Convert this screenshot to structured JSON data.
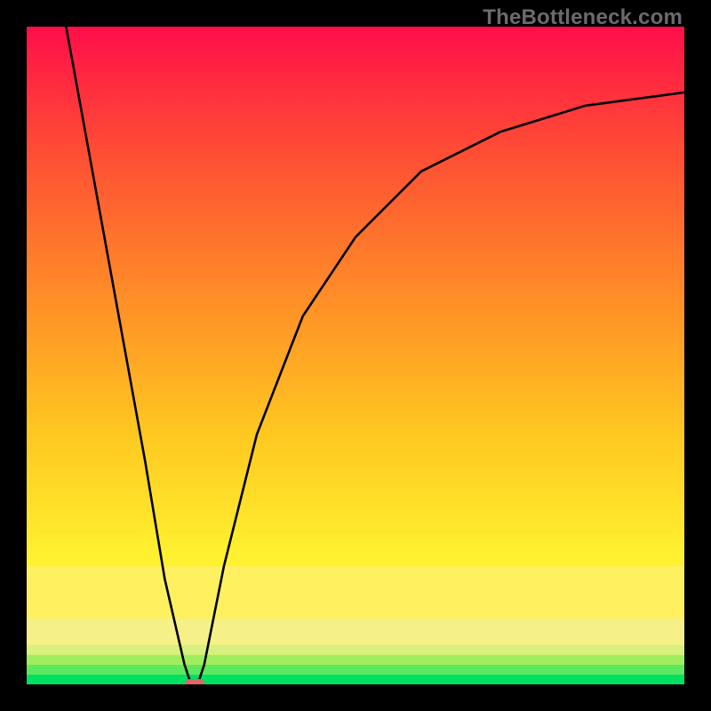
{
  "branding": "TheBottleneck.com",
  "chart_data": {
    "type": "line",
    "title": "",
    "xlabel": "",
    "ylabel": "",
    "xlim": [
      0,
      100
    ],
    "ylim": [
      0,
      100
    ],
    "grid": false,
    "curve_points": [
      {
        "x": 6,
        "y": 100
      },
      {
        "x": 10,
        "y": 78
      },
      {
        "x": 14,
        "y": 56
      },
      {
        "x": 18,
        "y": 34
      },
      {
        "x": 21,
        "y": 16
      },
      {
        "x": 24,
        "y": 3
      },
      {
        "x": 25,
        "y": 0
      },
      {
        "x": 26,
        "y": 0
      },
      {
        "x": 27,
        "y": 3
      },
      {
        "x": 30,
        "y": 18
      },
      {
        "x": 35,
        "y": 38
      },
      {
        "x": 42,
        "y": 56
      },
      {
        "x": 50,
        "y": 68
      },
      {
        "x": 60,
        "y": 78
      },
      {
        "x": 72,
        "y": 84
      },
      {
        "x": 85,
        "y": 88
      },
      {
        "x": 100,
        "y": 90
      }
    ],
    "annotation_marker": {
      "x": 25.5,
      "y": 0,
      "shape": "capsule",
      "color": "#e06666"
    },
    "bands": [
      {
        "from_y": 0.0,
        "to_y": 1.5,
        "color": "#00e060"
      },
      {
        "from_y": 1.5,
        "to_y": 3.0,
        "color": "#5ce860"
      },
      {
        "from_y": 3.0,
        "to_y": 4.5,
        "color": "#a0ee60"
      },
      {
        "from_y": 4.5,
        "to_y": 6.0,
        "color": "#d8f080"
      },
      {
        "from_y": 6.0,
        "to_y": 10.0,
        "color": "#f5f088"
      },
      {
        "from_y": 10.0,
        "to_y": 18.0,
        "color": "#fff060"
      }
    ],
    "gradient_stops": [
      {
        "offset": 0.0,
        "color": "#ff0e4a"
      },
      {
        "offset": 0.18,
        "color": "#ff4a35"
      },
      {
        "offset": 0.4,
        "color": "#ff8a28"
      },
      {
        "offset": 0.62,
        "color": "#ffc820"
      },
      {
        "offset": 0.8,
        "color": "#fff030"
      }
    ]
  }
}
